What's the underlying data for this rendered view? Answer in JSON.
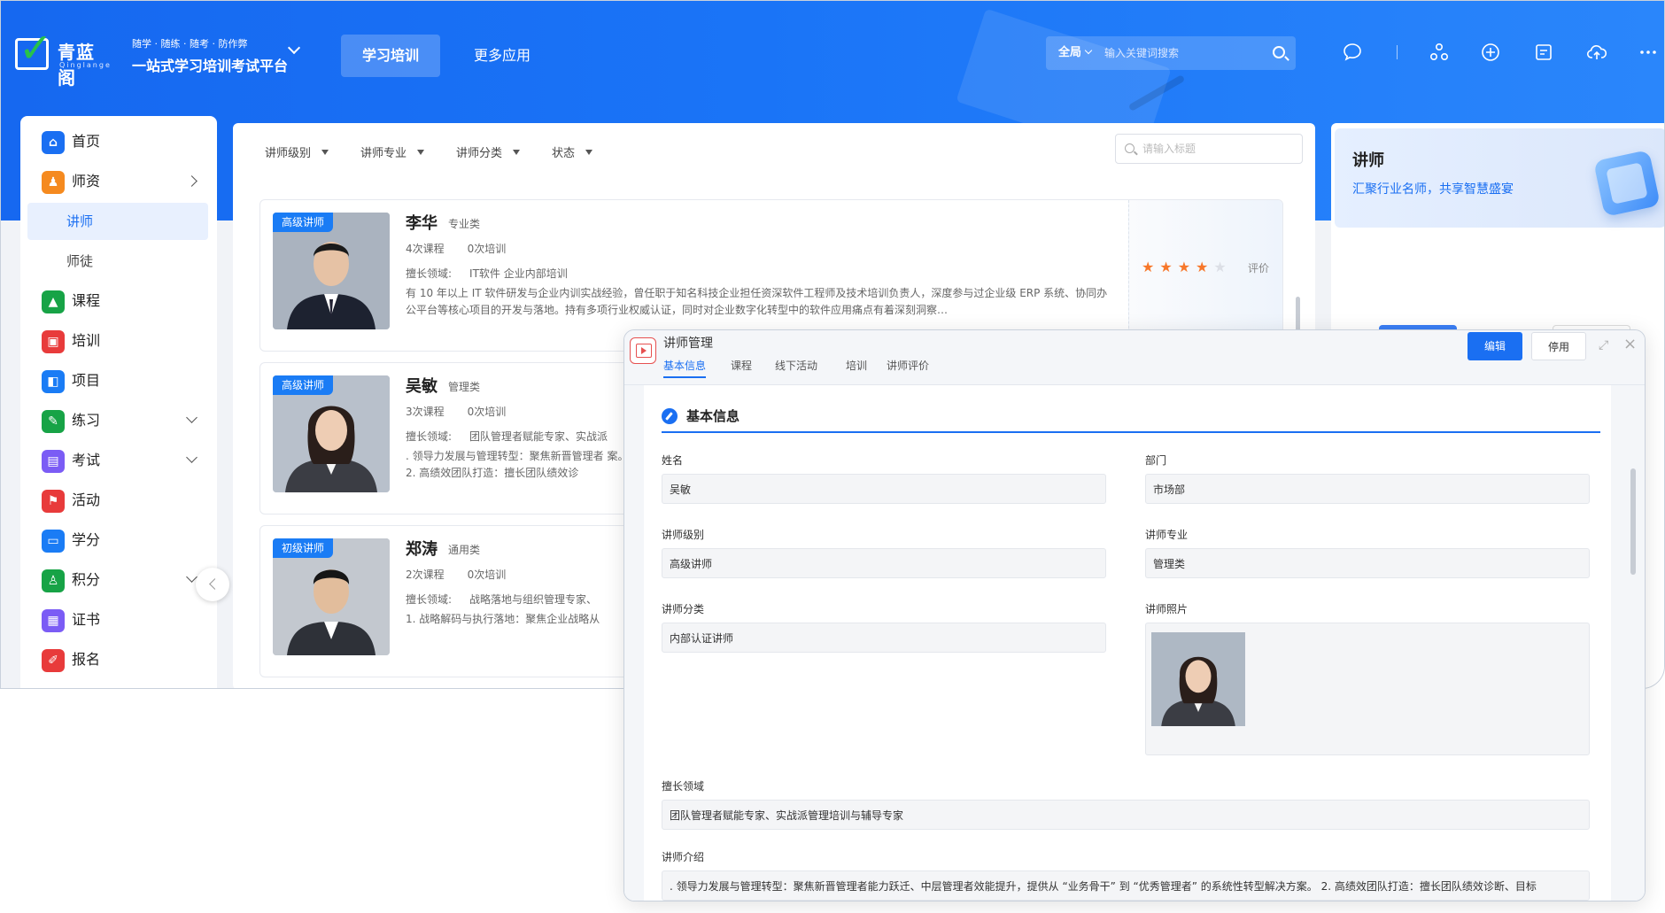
{
  "app": {
    "logo_text": "青蓝阁",
    "logo_sub": "Qinglange",
    "slogan_line1": "随学 · 随练 · 随考 · 防作弊",
    "slogan_line2": "一站式学习培训考试平台"
  },
  "topnav": {
    "tabs": [
      {
        "label": "学习培训",
        "active": true
      },
      {
        "label": "更多应用",
        "active": false
      }
    ],
    "search_scope": "全局",
    "search_placeholder": "输入关键词搜索",
    "icons": [
      "chat-icon",
      "apps-icon",
      "add-circle-icon",
      "task-icon",
      "upload-icon",
      "more-icon"
    ]
  },
  "sidebar": {
    "items": [
      {
        "label": "首页",
        "icon": "home-icon",
        "color": "#1a6ff2"
      },
      {
        "label": "师资",
        "icon": "teacher-icon",
        "color": "#f58a1f",
        "arrow": "right"
      },
      {
        "label": "讲师",
        "sub": true,
        "active": true
      },
      {
        "label": "师徒",
        "sub": true
      },
      {
        "label": "课程",
        "icon": "course-icon",
        "color": "#17a346"
      },
      {
        "label": "培训",
        "icon": "training-icon",
        "color": "#e83b3b"
      },
      {
        "label": "项目",
        "icon": "project-icon",
        "color": "#1a7cf5"
      },
      {
        "label": "练习",
        "icon": "practice-icon",
        "color": "#17a346",
        "arrow": "down"
      },
      {
        "label": "考试",
        "icon": "exam-icon",
        "color": "#7b5cf5",
        "arrow": "down"
      },
      {
        "label": "活动",
        "icon": "flag-icon",
        "color": "#e83b3b"
      },
      {
        "label": "学分",
        "icon": "credit-icon",
        "color": "#1a7cf5"
      },
      {
        "label": "积分",
        "icon": "points-icon",
        "color": "#17a346",
        "arrow": "down"
      },
      {
        "label": "证书",
        "icon": "certificate-icon",
        "color": "#7b5cf5"
      },
      {
        "label": "报名",
        "icon": "signup-icon",
        "color": "#e83b3b"
      }
    ]
  },
  "filters": {
    "items": [
      "讲师级别",
      "讲师专业",
      "讲师分类",
      "状态"
    ],
    "search_placeholder": "请输入标题"
  },
  "lecturers": [
    {
      "badge": "高级讲师",
      "name": "李华",
      "category": "专业类",
      "courses": "4次课程",
      "trainings": "0次培训",
      "field_label": "擅长领域:",
      "field_value": "IT软件 企业内部培训",
      "intro": "有 10 年以上 IT 软件研发与企业内训实战经验，曾任职于知名科技企业担任资深软件工程师及技术培训负责人，深度参与过企业级 ERP 系统、协同办公平台等核心项目的开发与落地。持有多项行业权威认证，同时对企业数字化转型中的软件应用痛点有着深刻洞察…",
      "rating": 4,
      "rate_label": "评价"
    },
    {
      "badge": "高级讲师",
      "name": "吴敏",
      "category": "管理类",
      "courses": "3次课程",
      "trainings": "0次培训",
      "field_label": "擅长领域:",
      "field_value": "团队管理者赋能专家、实战派",
      "intro": ". 领导力发展与管理转型：聚焦新晋管理者 案。 2. 高绩效团队打造：擅长团队绩效诊"
    },
    {
      "badge": "初级讲师",
      "name": "郑涛",
      "category": "通用类",
      "courses": "2次课程",
      "trainings": "0次培训",
      "field_label": "擅长领域:",
      "field_value": "战略落地与组织管理专家、",
      "intro": "1. 战略解码与执行落地：聚焦企业战略从"
    }
  ],
  "right_panel": {
    "title": "讲师",
    "subtitle": "汇聚行业名师，共享智慧盛宴"
  },
  "detail": {
    "window_title": "讲师管理",
    "tabs": [
      "基本信息",
      "课程",
      "线下活动",
      "培训",
      "讲师评价"
    ],
    "edit_label": "编辑",
    "disable_label": "停用",
    "section_title": "基本信息",
    "fields": {
      "name_label": "姓名",
      "name_value": "吴敏",
      "dept_label": "部门",
      "dept_value": "市场部",
      "level_label": "讲师级别",
      "level_value": "高级讲师",
      "major_label": "讲师专业",
      "major_value": "管理类",
      "class_label": "讲师分类",
      "class_value": "内部认证讲师",
      "photo_label": "讲师照片",
      "field_label": "擅长领域",
      "field_value": "团队管理者赋能专家、实战派管理培训与辅导专家",
      "intro_label": "讲师介绍",
      "intro_value": ". 领导力发展与管理转型：聚焦新晋管理者能力跃迁、中层管理者效能提升，提供从 “业务骨干” 到 “优秀管理者” 的系统性转型解决方案。 2. 高绩效团队打造：擅长团队绩效诊断、目标"
    }
  },
  "colors": {
    "primary": "#1a6ff2",
    "header_bg": "#1a74f7",
    "star": "#f7772a",
    "badge": "#1a7cf5"
  }
}
